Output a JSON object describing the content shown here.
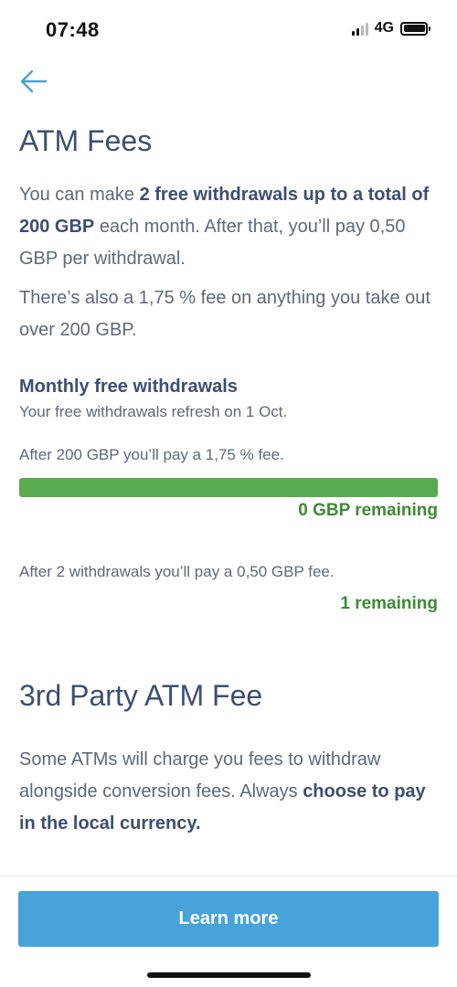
{
  "status_bar": {
    "time": "07:48",
    "network": "4G",
    "icons": [
      "signal-icon",
      "battery-icon"
    ]
  },
  "nav": {
    "back_icon": "arrow-left-icon",
    "back_color": "#4a9fd6"
  },
  "atm_fees": {
    "title": "ATM Fees",
    "intro_1": "You can make ",
    "intro_bold": "2 free withdrawals up to a total of 200 GBP",
    "intro_2": " each month. After that, you’ll pay 0,50 GBP per withdrawal.",
    "fee_note": "There’s also a 1,75 % fee on anything you take out over 200 GBP."
  },
  "monthly": {
    "heading": "Monthly free withdrawals",
    "refresh_note": "Your free withdrawals refresh on 1 Oct.",
    "amount_label": "After 200 GBP you’ll pay a 1,75 % fee.",
    "amount_used_fraction": 1.0,
    "amount_remaining": "0 GBP remaining",
    "count_label": "After 2 withdrawals you’ll pay a 0,50 GBP fee.",
    "count_remaining": "1 remaining"
  },
  "third_party": {
    "title": "3rd Party ATM Fee",
    "text_1": "Some ATMs will charge you fees to withdraw alongside conversion fees. Always ",
    "text_bold": "choose to pay in the local currency."
  },
  "footer": {
    "button_label": "Learn more"
  },
  "colors": {
    "heading": "#3d4e72",
    "body_text": "#5d6a78",
    "progress_green": "#5aaa51",
    "remaining_green": "#3d8a34",
    "button_blue": "#47a3da"
  }
}
